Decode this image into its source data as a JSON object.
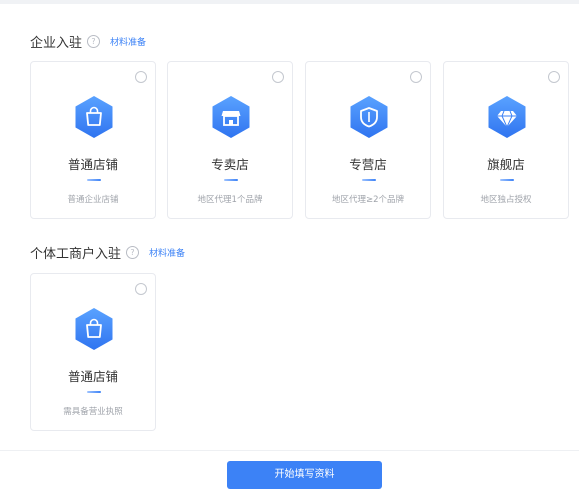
{
  "enterprise": {
    "title": "企业入驻",
    "help_glyph": "?",
    "prep_link": "材料准备",
    "cards": [
      {
        "name": "普通店铺",
        "desc": "普通企业店铺",
        "icon": "shopping-bag-icon"
      },
      {
        "name": "专卖店",
        "desc": "地区代理1个品牌",
        "icon": "store-icon"
      },
      {
        "name": "专营店",
        "desc": "地区代理≥2个品牌",
        "icon": "shield-icon"
      },
      {
        "name": "旗舰店",
        "desc": "地区独占授权",
        "icon": "diamond-icon"
      }
    ]
  },
  "individual": {
    "title": "个体工商户入驻",
    "help_glyph": "?",
    "prep_link": "材料准备",
    "cards": [
      {
        "name": "普通店铺",
        "desc": "需具备营业执照",
        "icon": "shopping-bag-icon"
      }
    ]
  },
  "footer": {
    "start_button": "开始填写资料"
  },
  "colors": {
    "accent": "#3c82f6",
    "icon_gradient_light": "#5aa2ff",
    "icon_gradient_dark": "#2f74f0",
    "card_border": "#e8eaef",
    "desc_text": "#a0a4ab"
  }
}
